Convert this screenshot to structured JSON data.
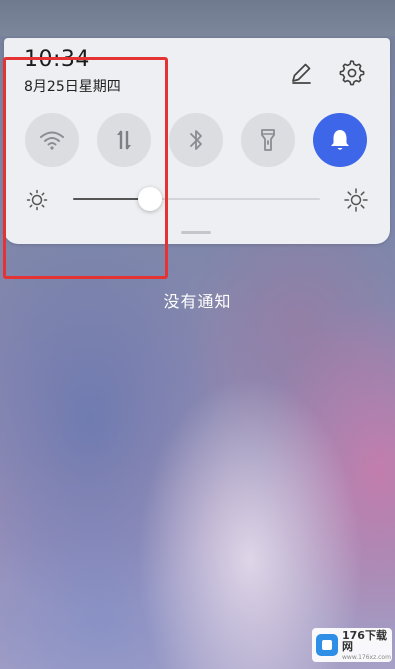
{
  "status": {
    "time": "10:34",
    "date": "8月25日星期四"
  },
  "header_icons": [
    {
      "icon": "pencil-icon"
    },
    {
      "icon": "gear-icon"
    }
  ],
  "quick_toggles": [
    {
      "icon": "wifi-icon",
      "active": false
    },
    {
      "icon": "mobile-data-icon",
      "active": false
    },
    {
      "icon": "bluetooth-icon",
      "active": false
    },
    {
      "icon": "flashlight-icon",
      "active": false
    },
    {
      "icon": "bell-icon",
      "active": true
    }
  ],
  "brightness": {
    "level": 0.31,
    "low_icon": "brightness-low-icon",
    "high_icon": "brightness-high-icon"
  },
  "notifications": {
    "empty_text": "没有通知"
  },
  "watermark": {
    "title": "176下载网",
    "subtitle": "www.176xz.com"
  },
  "colors": {
    "accent": "#3e66e8",
    "highlight_box": "#e53232",
    "panel_bg": "#eeeff2",
    "tile_inactive": "#dcdde1"
  }
}
